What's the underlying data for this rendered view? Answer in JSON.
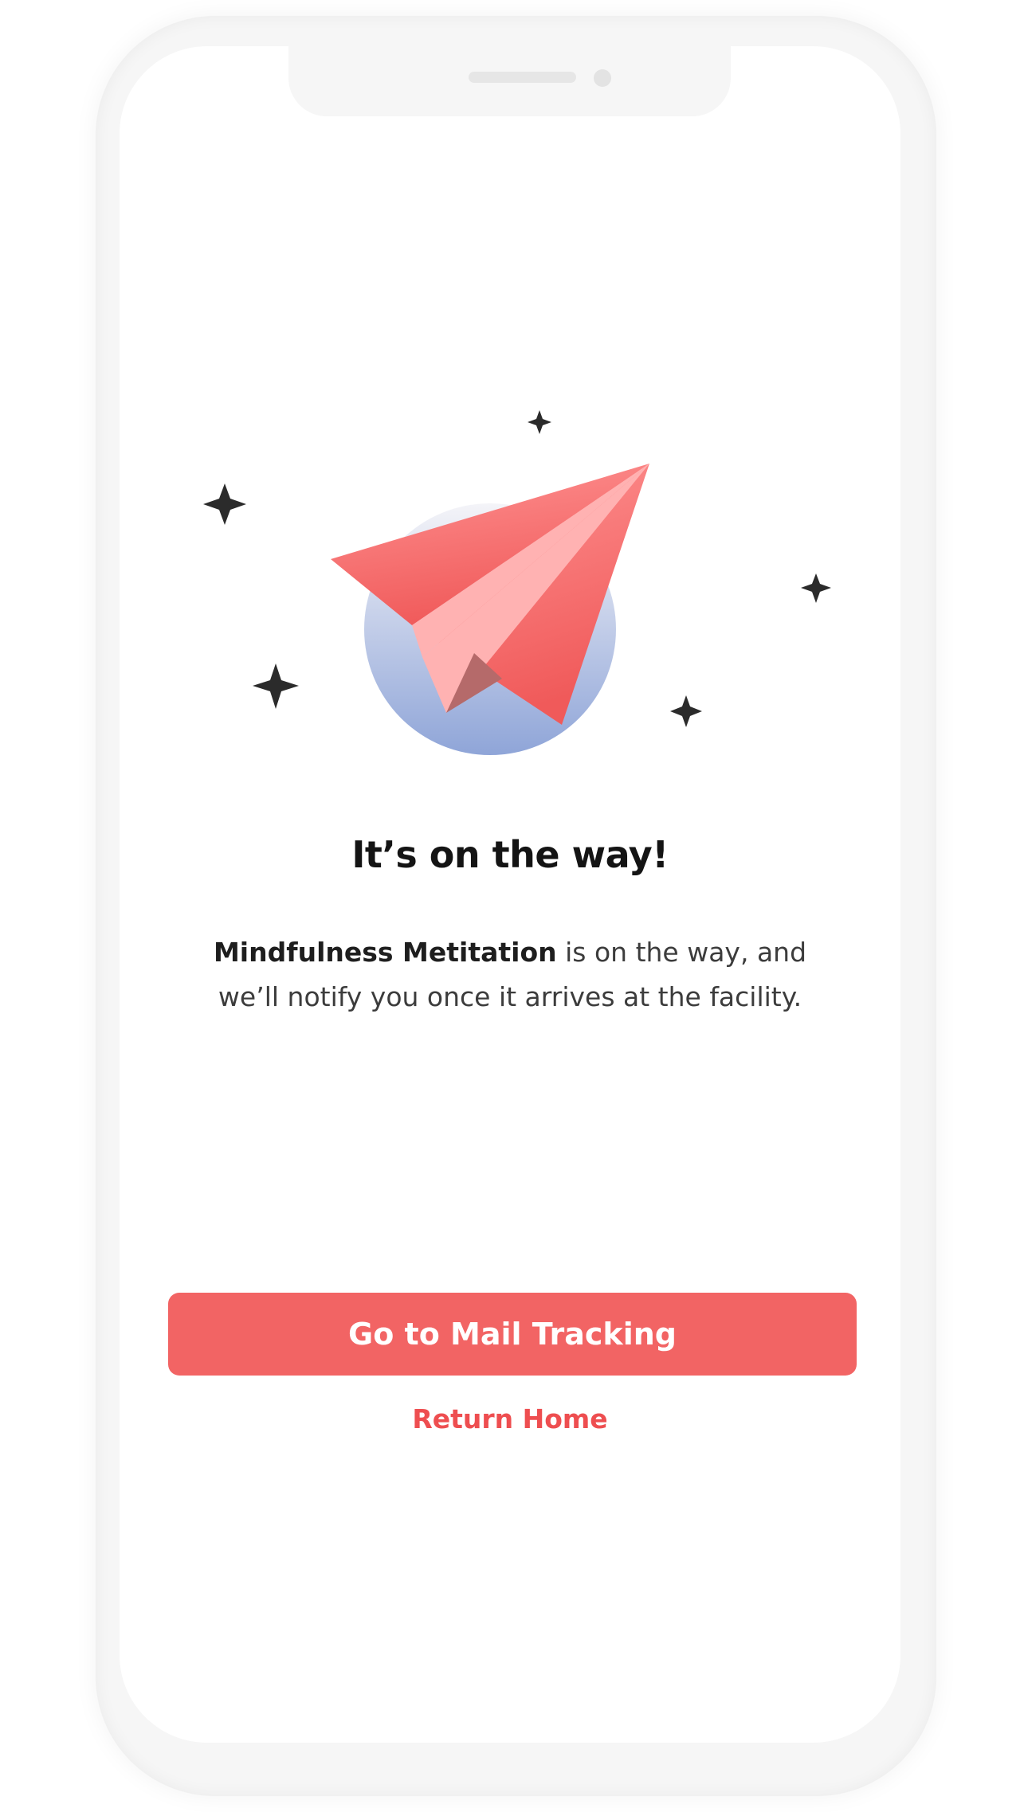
{
  "colors": {
    "accent": "#f26464",
    "link": "#ee4e50",
    "plane_top": "#ff9494",
    "plane_bottom": "#f05a5a",
    "plane_wing": "#ffb2b2",
    "plane_shadow": "#b56a6a",
    "circle_top": "#f4f4f8",
    "circle_bottom": "#8fa5d8",
    "sparkle": "#2b2b2b"
  },
  "illustration": {
    "icon": "paper-plane-icon",
    "decorations": "sparkle-icon"
  },
  "confirmation": {
    "title": "It’s on the way!",
    "item_name": "Mindfulness Metitation",
    "message_rest": " is on the way, and we’ll notify you once it arrives at the facility."
  },
  "actions": {
    "primary_label": "Go to Mail Tracking",
    "secondary_label": "Return Home"
  }
}
